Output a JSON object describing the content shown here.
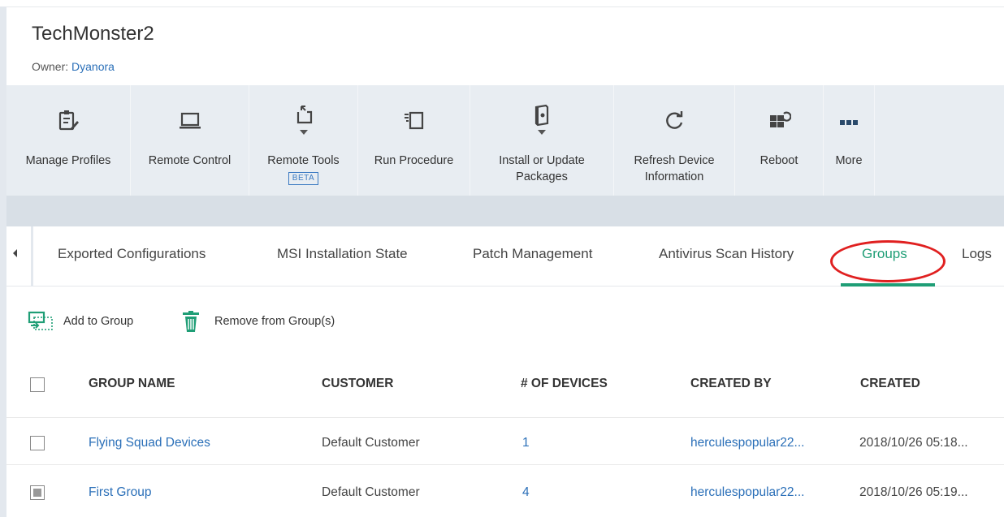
{
  "device": {
    "title": "TechMonster2",
    "owner_label": "Owner:",
    "owner_name": "Dyanora"
  },
  "toolbar": {
    "items": [
      {
        "icon": "manage-profiles-icon",
        "label": "Manage Profiles"
      },
      {
        "icon": "laptop-icon",
        "label": "Remote Control"
      },
      {
        "icon": "remote-tools-icon",
        "label": "Remote Tools",
        "badge": "BETA",
        "dropdown": true
      },
      {
        "icon": "run-procedure-icon",
        "label": "Run Procedure"
      },
      {
        "icon": "package-icon",
        "label_line1": "Install or Update",
        "label_line2": "Packages",
        "dropdown": true
      },
      {
        "icon": "refresh-icon",
        "label_line1": "Refresh Device",
        "label_line2": "Information"
      },
      {
        "icon": "reboot-icon",
        "label": "Reboot"
      },
      {
        "icon": "more-icon",
        "label": "More"
      }
    ]
  },
  "tabs": {
    "items": [
      "Exported Configurations",
      "MSI Installation State",
      "Patch Management",
      "Antivirus Scan History",
      "Groups",
      "Logs"
    ],
    "active": "Groups"
  },
  "actions": {
    "add_to_group": "Add to Group",
    "remove_from_group": "Remove from Group(s)"
  },
  "table": {
    "columns": [
      "GROUP NAME",
      "CUSTOMER",
      "# OF DEVICES",
      "CREATED BY",
      "CREATED"
    ],
    "rows": [
      {
        "checked": false,
        "group_name": "Flying Squad Devices",
        "customer": "Default Customer",
        "devices": "1",
        "created_by": "herculespopular22...",
        "created": "2018/10/26 05:18..."
      },
      {
        "checked": true,
        "group_name": "First Group",
        "customer": "Default Customer",
        "devices": "4",
        "created_by": "herculespopular22...",
        "created": "2018/10/26 05:19..."
      }
    ]
  },
  "colors": {
    "accent_green": "#1f9e76",
    "link_blue": "#2a6fb8",
    "highlight_red": "#e02020",
    "toolbar_bg": "#e8edf2"
  }
}
